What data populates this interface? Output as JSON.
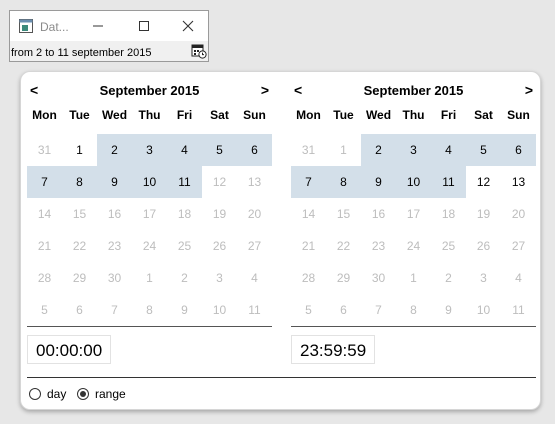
{
  "window": {
    "title": "Dat...",
    "range_text": "from 2 to 11 september 2015",
    "icons": [
      "app-icon",
      "minimize-icon",
      "maximize-icon",
      "close-icon",
      "calendar-clock-icon"
    ]
  },
  "picker": {
    "prev_label": "<",
    "next_label": ">",
    "weekdays": [
      "Mon",
      "Tue",
      "Wed",
      "Thu",
      "Fri",
      "Sat",
      "Sun"
    ],
    "left": {
      "month": "September 2015",
      "time": "00:00:00",
      "days": [
        [
          "31",
          "1",
          "2",
          "3",
          "4",
          "5",
          "6"
        ],
        [
          "7",
          "8",
          "9",
          "10",
          "11",
          "12",
          "13"
        ],
        [
          "14",
          "15",
          "16",
          "17",
          "18",
          "19",
          "20"
        ],
        [
          "21",
          "22",
          "23",
          "24",
          "25",
          "26",
          "27"
        ],
        [
          "28",
          "29",
          "30",
          "1",
          "2",
          "3",
          "4"
        ],
        [
          "5",
          "6",
          "7",
          "8",
          "9",
          "10",
          "11"
        ]
      ]
    },
    "right": {
      "month": "September 2015",
      "time": "23:59:59",
      "days": [
        [
          "31",
          "1",
          "2",
          "3",
          "4",
          "5",
          "6"
        ],
        [
          "7",
          "8",
          "9",
          "10",
          "11",
          "12",
          "13"
        ],
        [
          "14",
          "15",
          "16",
          "17",
          "18",
          "19",
          "20"
        ],
        [
          "21",
          "22",
          "23",
          "24",
          "25",
          "26",
          "27"
        ],
        [
          "28",
          "29",
          "30",
          "1",
          "2",
          "3",
          "4"
        ],
        [
          "5",
          "6",
          "7",
          "8",
          "9",
          "10",
          "11"
        ]
      ]
    },
    "mode": {
      "options": [
        "day",
        "range"
      ],
      "selected": "range"
    },
    "colors": {
      "selected_bg": "#d3dfe9",
      "muted_text": "#bdbdbd"
    }
  }
}
